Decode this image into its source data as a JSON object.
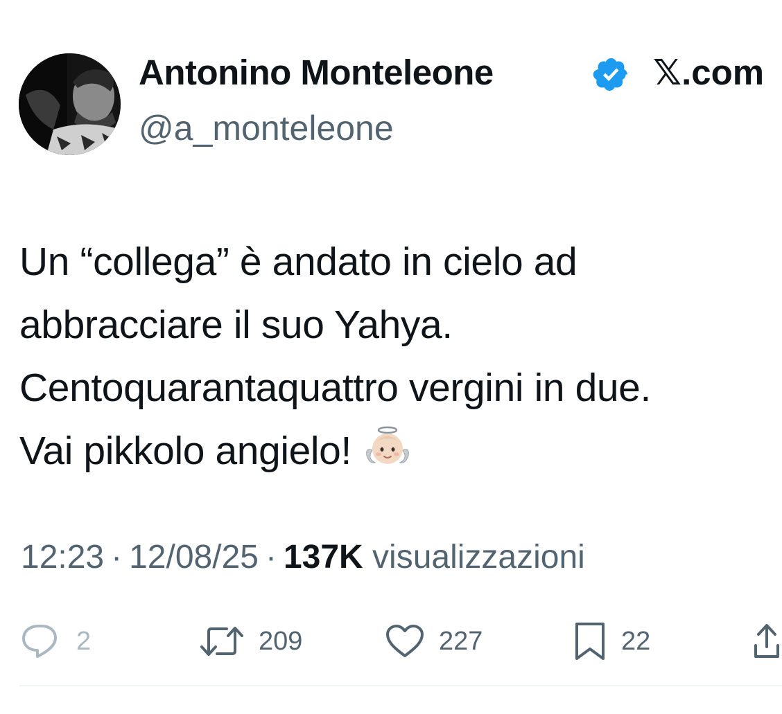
{
  "author": {
    "display_name": "Antonino Monteleone",
    "handle": "@a_monteleone",
    "verified": true,
    "verified_color": "#1d9bf0",
    "avatar_icon": "user-avatar-photo"
  },
  "site": {
    "label": "𝕏.com"
  },
  "tweet": {
    "lines": [
      "Un “collega” è andato in cielo ad",
      "abbracciare il suo Yahya.",
      "Centoquarantaquattro vergini in due.",
      "Vai pikkolo angielo!"
    ],
    "emoji_icon": "baby-angel-emoji"
  },
  "meta": {
    "time": "12:23",
    "separator": "·",
    "date": "12/08/25",
    "views_count": "137K",
    "views_label": "visualizzazioni"
  },
  "actions": {
    "replies": "2",
    "retweets": "209",
    "likes": "227",
    "bookmarks": "22"
  },
  "colors": {
    "text": "#0f1419",
    "secondary": "#536471",
    "disabled": "#aab8c2",
    "accent": "#1d9bf0"
  }
}
